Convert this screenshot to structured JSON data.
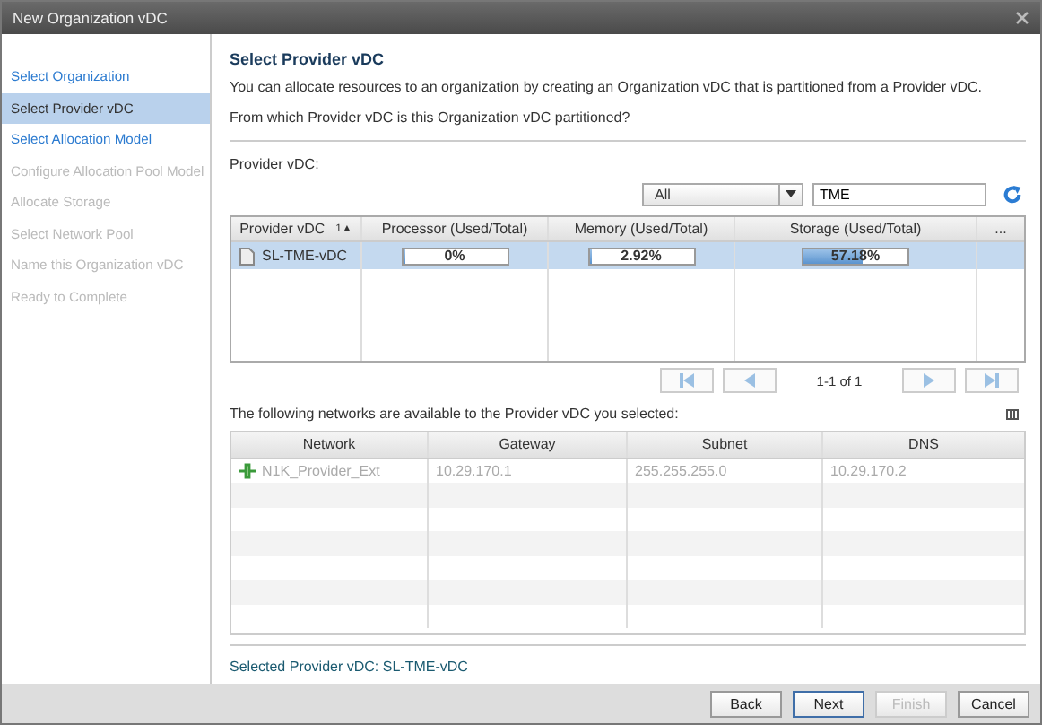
{
  "window": {
    "title": "New Organization vDC"
  },
  "steps": [
    {
      "label": "Select Organization",
      "selected": false,
      "disabled": false
    },
    {
      "label": "Select Provider vDC",
      "selected": true,
      "disabled": false
    },
    {
      "label": "Select Allocation Model",
      "selected": false,
      "disabled": false
    },
    {
      "label": "Configure Allocation Pool Model",
      "selected": false,
      "disabled": true
    },
    {
      "label": "Allocate Storage",
      "selected": false,
      "disabled": true
    },
    {
      "label": "Select Network Pool",
      "selected": false,
      "disabled": true
    },
    {
      "label": "Name this Organization vDC",
      "selected": false,
      "disabled": true
    },
    {
      "label": "Ready to Complete",
      "selected": false,
      "disabled": true
    }
  ],
  "page": {
    "heading": "Select Provider vDC",
    "description": "You can allocate resources to an organization by creating an Organization vDC that is partitioned from a Provider vDC.",
    "question": "From which Provider vDC is this Organization vDC partitioned?",
    "field_label": "Provider vDC:"
  },
  "filter": {
    "scope": "All",
    "search": "TME"
  },
  "provider_table": {
    "columns": [
      {
        "label": "Provider vDC",
        "sort": "1▲"
      },
      {
        "label": "Processor (Used/Total)"
      },
      {
        "label": "Memory (Used/Total)"
      },
      {
        "label": "Storage (Used/Total)"
      },
      {
        "label": "..."
      }
    ],
    "rows": [
      {
        "name": "SL-TME-vDC",
        "selected": true,
        "processor": {
          "level": 0,
          "reading": "0%"
        },
        "memory": {
          "level": 0.0292,
          "reading": "2.92%"
        },
        "storage": {
          "level": 0.5718,
          "reading": "57.18%"
        }
      }
    ]
  },
  "pagination": {
    "range": "1-1 of 1"
  },
  "networks_caption": "The following networks are available to the Provider vDC you selected:",
  "network_table": {
    "columns": [
      "Network",
      "Gateway",
      "Subnet",
      "DNS"
    ],
    "rows": [
      {
        "network": "N1K_Provider_Ext",
        "gateway": "10.29.170.1",
        "subnet": "255.255.255.0",
        "dns": "10.29.170.2"
      }
    ]
  },
  "selection_summary": "Selected Provider vDC: SL-TME-vDC",
  "buttons": [
    {
      "label": "Back",
      "disabled": false,
      "default": false
    },
    {
      "label": "Next",
      "disabled": false,
      "default": true
    },
    {
      "label": "Finish",
      "disabled": true,
      "default": false
    },
    {
      "label": "Cancel",
      "disabled": false,
      "default": false
    }
  ]
}
